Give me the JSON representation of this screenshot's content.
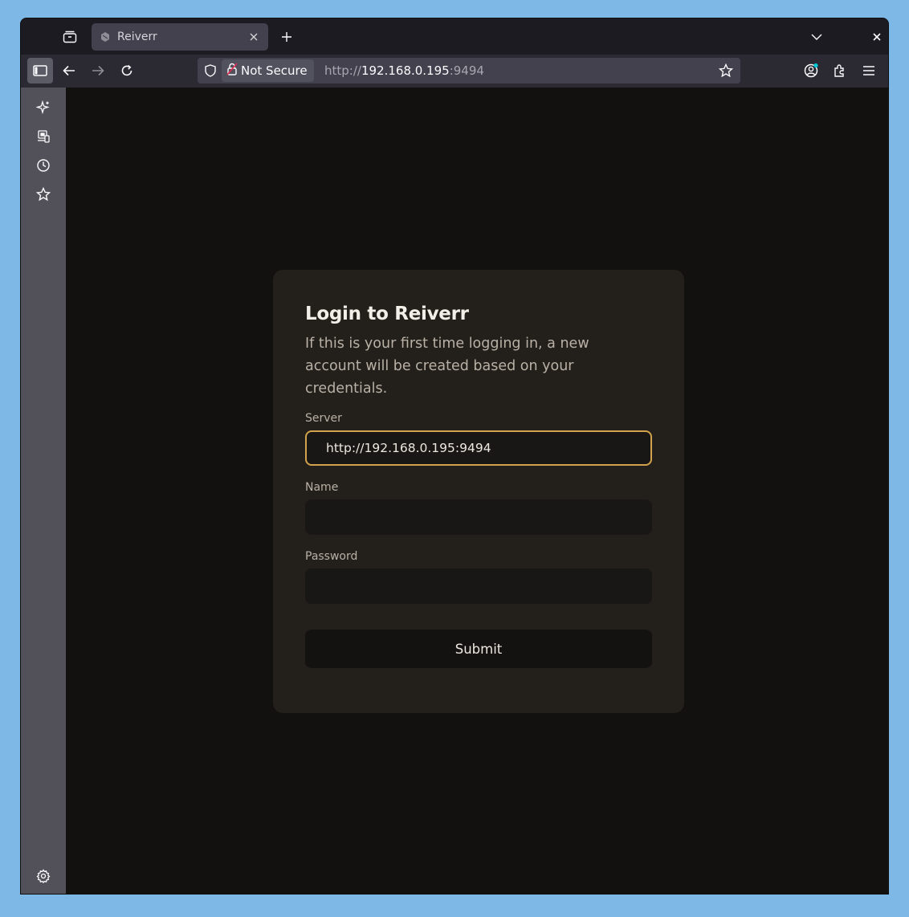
{
  "browser": {
    "tab": {
      "title": "Reiverr"
    },
    "urlbar": {
      "security_label": "Not Secure",
      "url_prefix": "http://",
      "url_host": "192.168.0.195",
      "url_suffix": ":9494"
    }
  },
  "sidebar": {
    "items": [
      {
        "icon": "ai-sparkle-icon"
      },
      {
        "icon": "synced-tabs-icon"
      },
      {
        "icon": "history-icon"
      },
      {
        "icon": "bookmarks-icon"
      }
    ],
    "settings_icon": "gear-icon"
  },
  "login": {
    "title": "Login to Reiverr",
    "description": "If this is your first time logging in, a new account will be created based on your credentials.",
    "server_label": "Server",
    "server_value": "http://192.168.0.195:9494",
    "name_label": "Name",
    "name_value": "",
    "password_label": "Password",
    "password_value": "",
    "submit_label": "Submit"
  },
  "colors": {
    "accent": "#d4a24c",
    "page_background": "#131110",
    "card_background": "#231f1a"
  }
}
